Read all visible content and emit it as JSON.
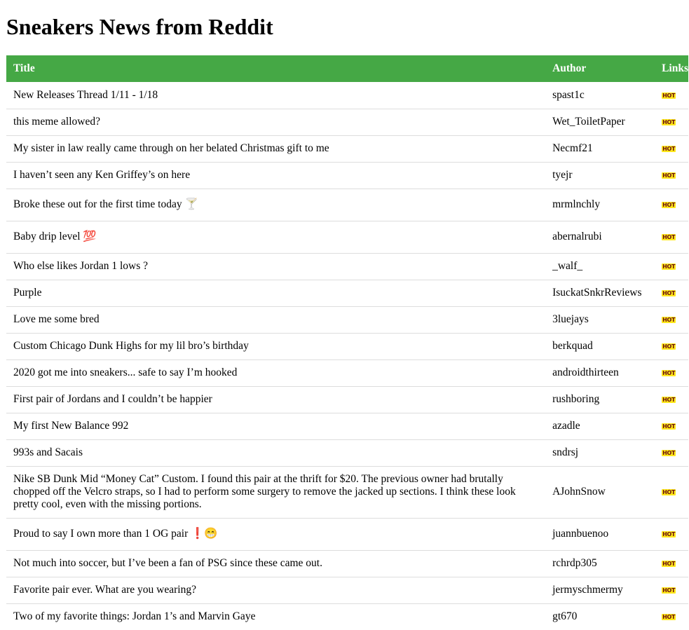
{
  "page": {
    "title": "Sneakers News from Reddit"
  },
  "table": {
    "headers": {
      "title": "Title",
      "author": "Author",
      "links": "Links"
    },
    "hot_label": "HOT",
    "rows": [
      {
        "title": "New Releases Thread 1/11 - 1/18",
        "author": "spast1c"
      },
      {
        "title": "this meme allowed?",
        "author": "Wet_ToiletPaper"
      },
      {
        "title": "My sister in law really came through on her belated Christmas gift to me",
        "author": "Necmf21"
      },
      {
        "title": "I haven’t seen any Ken Griffey’s on here",
        "author": "tyejr"
      },
      {
        "title": "Broke these out for the first time today 🍸",
        "author": "mrmlnchly"
      },
      {
        "title": "Baby drip level 💯",
        "author": "abernalrubi"
      },
      {
        "title": "Who else likes Jordan 1 lows ?",
        "author": "_walf_"
      },
      {
        "title": "Purple",
        "author": "IsuckatSnkrReviews"
      },
      {
        "title": "Love me some bred",
        "author": "3luejays"
      },
      {
        "title": "Custom Chicago Dunk Highs for my lil bro’s birthday",
        "author": "berkquad"
      },
      {
        "title": "2020 got me into sneakers... safe to say I’m hooked",
        "author": "androidthirteen"
      },
      {
        "title": "First pair of Jordans and I couldn’t be happier",
        "author": "rushboring"
      },
      {
        "title": "My first New Balance 992",
        "author": "azadle"
      },
      {
        "title": "993s and Sacais",
        "author": "sndrsj"
      },
      {
        "title": "Nike SB Dunk Mid “Money Cat” Custom. I found this pair at the thrift for $20. The previous owner had brutally chopped off the Velcro straps, so I had to perform some surgery to remove the jacked up sections. I think these look pretty cool, even with the missing portions.",
        "author": "AJohnSnow"
      },
      {
        "title": "Proud to say I own more than 1 OG pair ❗😁",
        "author": "juannbuenoo"
      },
      {
        "title": "Not much into soccer, but I’ve been a fan of PSG since these came out.",
        "author": "rchrdp305"
      },
      {
        "title": "Favorite pair ever. What are you wearing?",
        "author": "jermyschmermy"
      },
      {
        "title": "Two of my favorite things: Jordan 1’s and Marvin Gaye",
        "author": "gt670"
      }
    ]
  }
}
